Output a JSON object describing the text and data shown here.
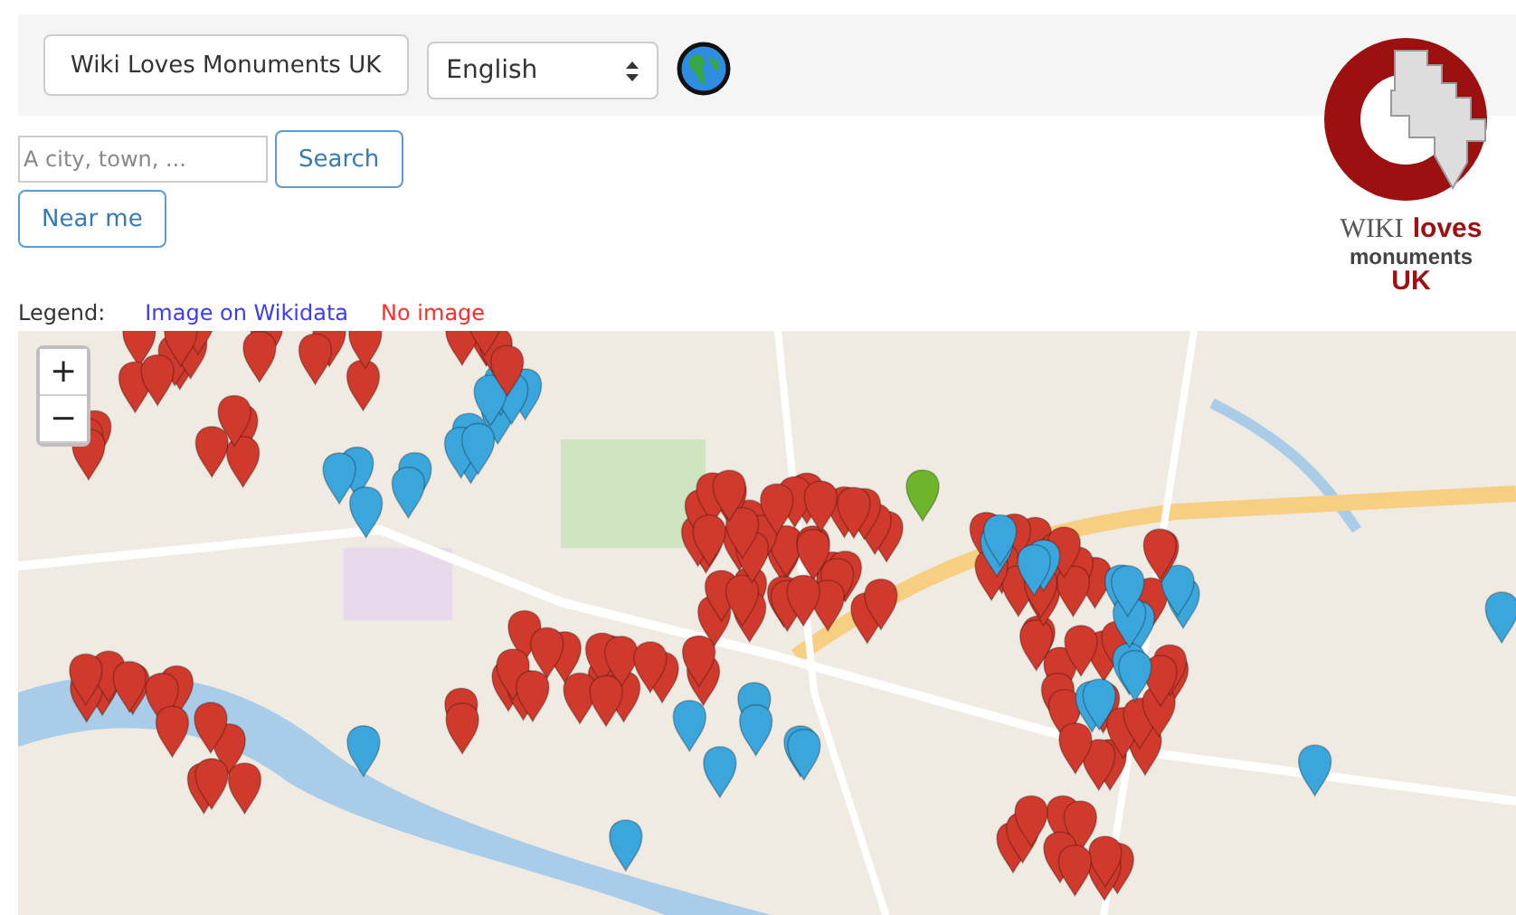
{
  "header": {
    "site_button": "Wiki Loves Monuments UK",
    "language": {
      "value": "English"
    }
  },
  "search": {
    "placeholder": "A city, town, ...",
    "button": "Search",
    "near_button": "Near me"
  },
  "logo": {
    "wiki": "WIKI",
    "loves": "loves",
    "monuments": "monuments",
    "country": "UK"
  },
  "legend": {
    "label": "Legend:",
    "items": [
      {
        "label": "Image on Wikidata",
        "color": "#3b3bff"
      },
      {
        "label": "No image",
        "color": "#ff2a2a"
      }
    ]
  },
  "map": {
    "zoom_in": "+",
    "zoom_out": "−"
  }
}
